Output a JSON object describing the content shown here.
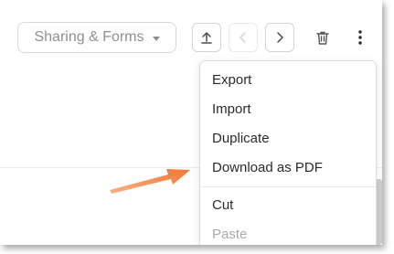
{
  "toolbar": {
    "sharing_label": "Sharing & Forms",
    "buttons": [
      "upload-icon",
      "chevron-left-icon",
      "chevron-right-icon",
      "trash-icon",
      "more-vertical-icon"
    ]
  },
  "menu": {
    "items": [
      {
        "label": "Export",
        "enabled": true
      },
      {
        "label": "Import",
        "enabled": true
      },
      {
        "label": "Duplicate",
        "enabled": true
      },
      {
        "label": "Download as PDF",
        "enabled": true
      },
      {
        "label": "Cut",
        "enabled": true
      },
      {
        "label": "Paste",
        "enabled": false
      }
    ]
  },
  "colors": {
    "annotation_arrow": "#f07f3c",
    "text": "#2a2a2e",
    "muted": "#8e8e96"
  }
}
